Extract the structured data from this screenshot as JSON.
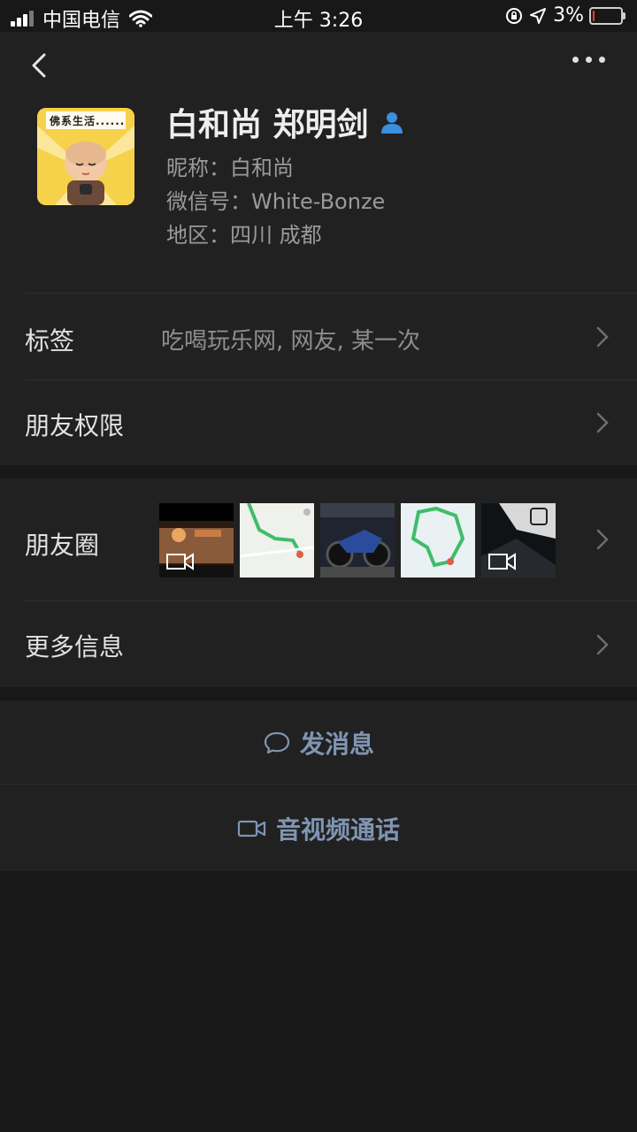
{
  "status_bar": {
    "carrier": "中国电信",
    "time": "上午 3:26",
    "battery_pct": "3%",
    "battery_level": 0.03
  },
  "profile": {
    "name": "白和尚 郑明剑",
    "nickname": "昵称：白和尚",
    "wechat_id": "微信号：White-Bonze",
    "region": "地区：四川 成都",
    "avatar_caption": "佛系生活......"
  },
  "rows": {
    "tags_label": "标签",
    "tags_value": "吃喝玩乐网, 网友, 某一次",
    "permissions_label": "朋友权限",
    "moments_label": "朋友圈",
    "more_info_label": "更多信息"
  },
  "actions": {
    "message_label": "发消息",
    "call_label": "音视频通话"
  },
  "colors": {
    "accent": "#7f95b3",
    "background": "#181818",
    "panel": "#212121",
    "user_icon": "#3a8fe0"
  }
}
